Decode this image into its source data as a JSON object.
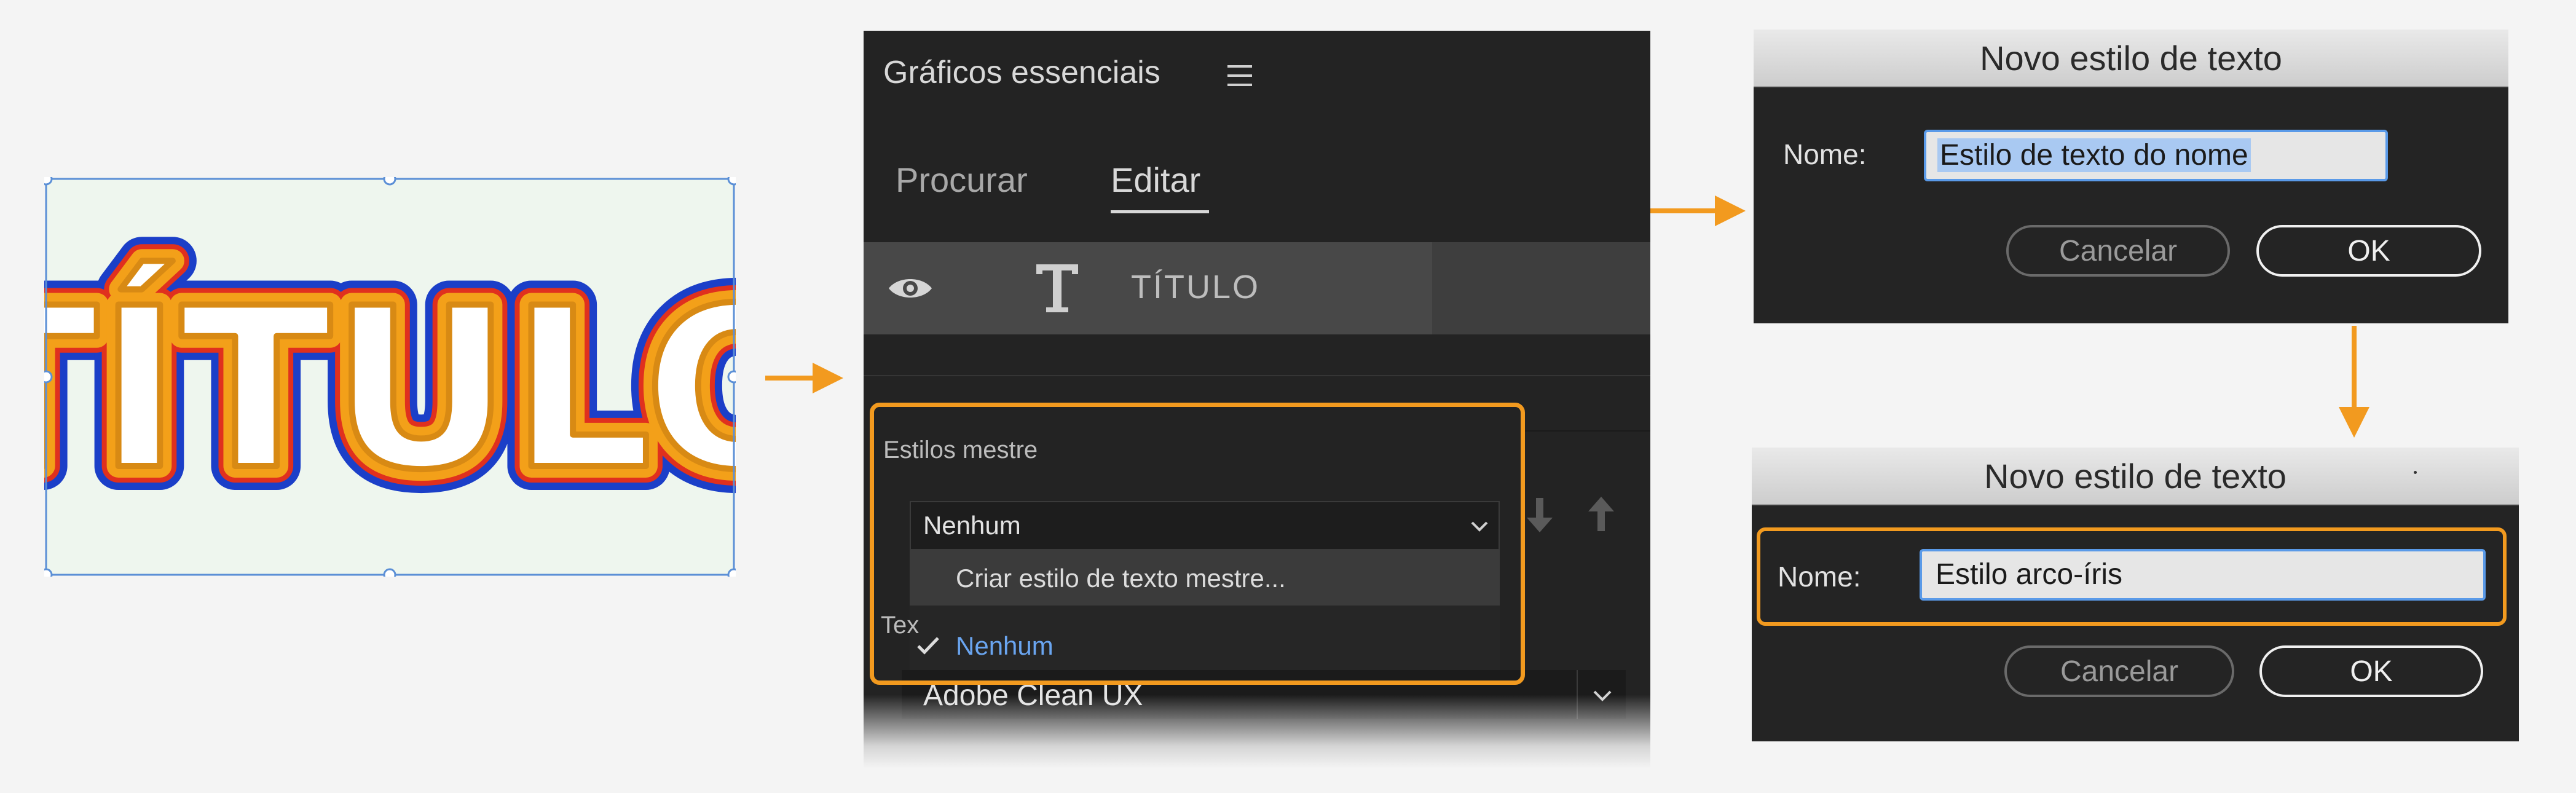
{
  "graphic": {
    "title_text": "TÍTULO",
    "colors": {
      "outer": "#1b3fc8",
      "red": "#e0301e",
      "orange": "#f3a019",
      "gold": "#d88a14",
      "fill": "#ffffff"
    }
  },
  "panel": {
    "title": "Gráficos essenciais",
    "tabs": [
      {
        "label": "Procurar"
      },
      {
        "label": "Editar"
      }
    ],
    "layer": {
      "name": "TÍTULO",
      "icons": [
        "eye-icon",
        "text-type-icon"
      ]
    },
    "master_styles": {
      "label": "Estilos mestre",
      "selected": "Nenhum",
      "menu_items": [
        {
          "label": "Criar estilo de texto mestre..."
        },
        {
          "label": "Nenhum",
          "checked": true
        }
      ]
    },
    "text_section_label": "Tex",
    "font": {
      "name": "Adobe Clean UX"
    }
  },
  "dialogs": [
    {
      "title": "Novo estilo de texto",
      "name_label": "Nome:",
      "name_value": "Estilo de texto do nome",
      "cancel_label": "Cancelar",
      "ok_label": "OK"
    },
    {
      "title": "Novo estilo de texto",
      "name_label": "Nome:",
      "name_value": "Estilo arco-íris",
      "cancel_label": "Cancelar",
      "ok_label": "OK"
    }
  ],
  "accent_color": "#f29a1f",
  "selection_color": "#5b8fd6"
}
